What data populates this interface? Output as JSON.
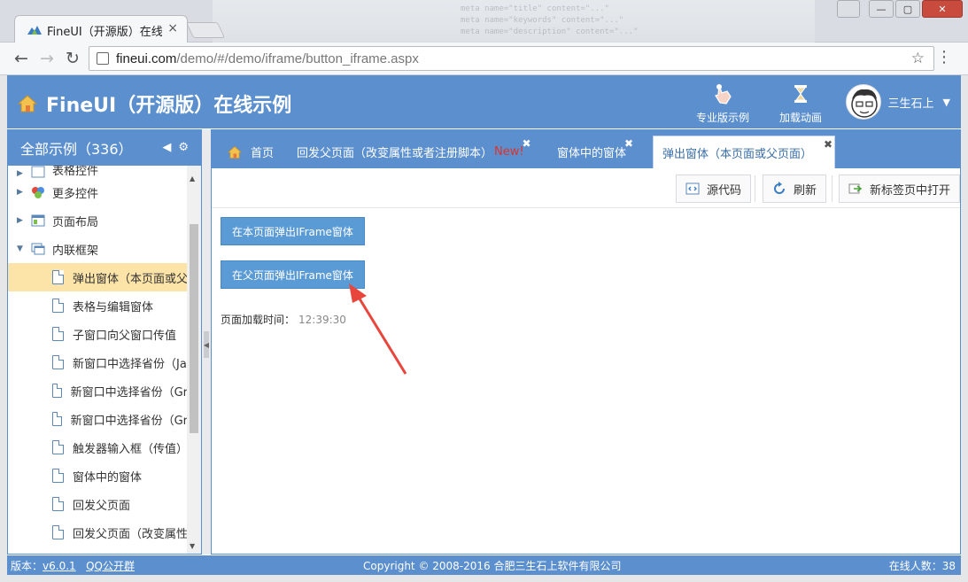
{
  "browser": {
    "tab_title": "FineUI（开源版）在线示",
    "tab_close": "×",
    "url_host": "fineui.com",
    "url_path": "/demo/#/demo/iframe/button_iframe.aspx",
    "window_buttons": [
      "—",
      "▢",
      "✕"
    ],
    "background_code": "meta name=\"title\" content=\"...\"\nmeta name=\"keywords\" content=\"...\"\nmeta name=\"description\" content=\"...\""
  },
  "header": {
    "title": "FineUI（开源版）在线示例",
    "actions": [
      {
        "label": "专业版示例",
        "icon": "hand-pointer-icon"
      },
      {
        "label": "加载动画",
        "icon": "hourglass-icon"
      }
    ],
    "user_name": "三生石上"
  },
  "sidebar": {
    "title": "全部示例（336）",
    "items": [
      {
        "label": "表格控件",
        "type": "folder",
        "partial": true
      },
      {
        "label": "更多控件",
        "type": "folder"
      },
      {
        "label": "页面布局",
        "type": "folder"
      },
      {
        "label": "内联框架",
        "type": "folder-open"
      },
      {
        "label": "弹出窗体（本页面或父",
        "type": "leaf",
        "selected": true
      },
      {
        "label": "表格与编辑窗体",
        "type": "leaf"
      },
      {
        "label": "子窗口向父窗口传值",
        "type": "leaf"
      },
      {
        "label": "新窗口中选择省份（Ja",
        "type": "leaf"
      },
      {
        "label": "新窗口中选择省份（Gr",
        "type": "leaf"
      },
      {
        "label": "新窗口中选择省份（Gr",
        "type": "leaf"
      },
      {
        "label": "触发器输入框（传值）",
        "type": "leaf"
      },
      {
        "label": "窗体中的窗体",
        "type": "leaf"
      },
      {
        "label": "回发父页面",
        "type": "leaf"
      },
      {
        "label": "回发父页面（改变属性",
        "type": "leaf"
      }
    ]
  },
  "main": {
    "tabs": [
      {
        "label": "首页",
        "closable": false
      },
      {
        "label": "回发父页面（改变属性或者注册脚本）",
        "new": "New!",
        "closable": true
      },
      {
        "label": "窗体中的窗体",
        "closable": true
      },
      {
        "label": "弹出窗体（本页面或父页面）",
        "closable": true,
        "active": true
      }
    ],
    "tab_close": "✖",
    "toolbar": {
      "source": "源代码",
      "refresh": "刷新",
      "open_new_tab": "新标签页中打开"
    },
    "buttons": {
      "current_page": "在本页面弹出IFrame窗体",
      "parent_page": "在父页面弹出IFrame窗体"
    },
    "load_time_label": "页面加载时间：",
    "load_time_value": "12:39:30"
  },
  "footer": {
    "version_label": "版本：",
    "version": "v6.0.1",
    "qq": "QQ公开群",
    "copyright": "Copyright © 2008-2016 合肥三生石上软件有限公司",
    "online": "在线人数：38"
  },
  "colors": {
    "brand": "#5b8fcd",
    "selected": "#fce4a8",
    "button": "#5b9bd5",
    "new_badge": "#e0322c",
    "arrow": "#e8463c"
  }
}
